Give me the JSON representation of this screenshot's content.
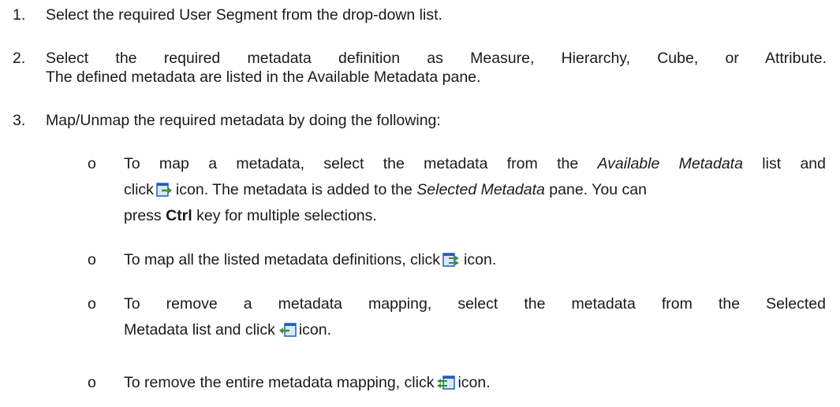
{
  "steps": [
    {
      "num": "1.",
      "text": "Select the required User Segment from the drop-down list."
    },
    {
      "num": "2.",
      "line1": "Select the required metadata definition as Measure, Hierarchy, Cube, or Attribute.",
      "line2": "The defined metadata are listed in the Available Metadata pane."
    },
    {
      "num": "3.",
      "text": "Map/Unmap the required metadata by doing the following:"
    }
  ],
  "bullet_symbol": "o",
  "bullets": {
    "map_one": {
      "l1_a": "To map a metadata, select the metadata from the ",
      "l1_em": "Available Metadata",
      "l1_b": " list and",
      "l2_a": "click",
      "l2_b": "icon. The metadata is added to the ",
      "l2_em": "Selected Metadata",
      "l2_c": " pane. You can",
      "l3_a": "press ",
      "l3_strong": "Ctrl",
      "l3_b": " key for multiple selections."
    },
    "map_all": {
      "a": "To map all the listed metadata definitions, click",
      "b": "icon."
    },
    "remove_one": {
      "l1": "To remove a metadata mapping, select the metadata from the Selected",
      "l2_a": "Metadata list and click",
      "l2_b": "icon."
    },
    "remove_all": {
      "a": "To remove the entire metadata mapping, click",
      "b": "icon."
    }
  },
  "icons": {
    "map_one": "map-selected-icon",
    "map_all": "map-all-icon",
    "remove_one": "unmap-selected-icon",
    "remove_all": "unmap-all-icon"
  },
  "colors": {
    "icon_blue": "#1f5fb8",
    "icon_green": "#3a8f3a",
    "text": "#1a1a1a"
  }
}
